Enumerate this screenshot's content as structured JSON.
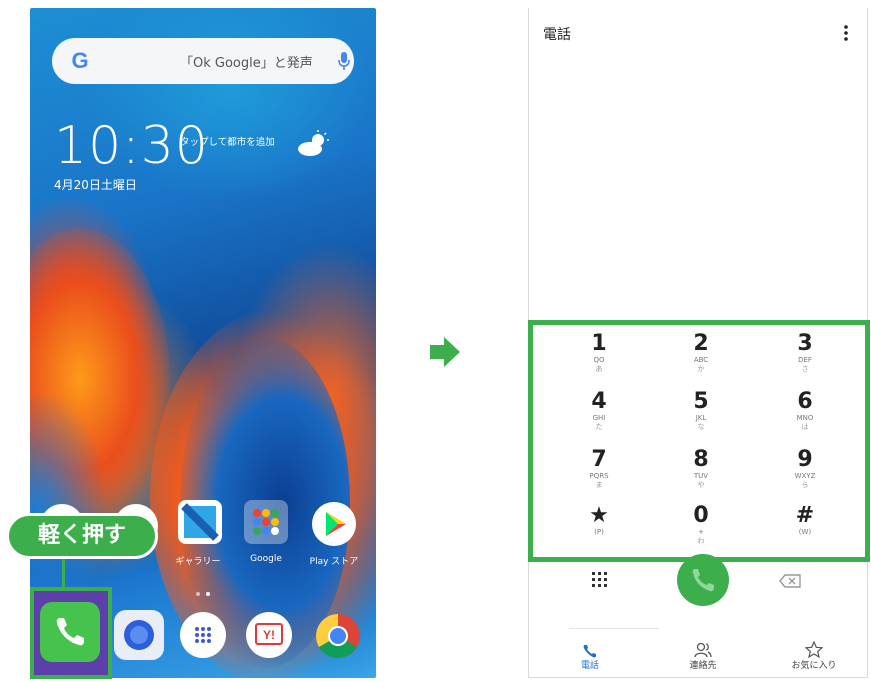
{
  "home": {
    "search_hint": "「Ok Google」と発声",
    "clock": "10:30",
    "city_hint": "タップして都市を追加",
    "date": "4月20日土曜日",
    "apps_row1": [
      {
        "label": "",
        "icon": "maps-icon"
      },
      {
        "label": "",
        "icon": "calendar-icon"
      },
      {
        "label": "ギャラリー",
        "icon": "gallery-icon"
      },
      {
        "label": "Google",
        "icon": "google-folder-icon"
      },
      {
        "label": "Play ストア",
        "icon": "play-store-icon"
      }
    ],
    "dock": [
      {
        "icon": "phone-icon"
      },
      {
        "icon": "camera-icon"
      },
      {
        "icon": "app-drawer-icon"
      },
      {
        "icon": "yahoo-icon"
      },
      {
        "icon": "chrome-icon"
      }
    ]
  },
  "callout": {
    "text": "軽く押す"
  },
  "dialer": {
    "title": "電話",
    "keys": [
      {
        "digit": "1",
        "letters": "QO",
        "kana": "あ"
      },
      {
        "digit": "2",
        "letters": "ABC",
        "kana": "か"
      },
      {
        "digit": "3",
        "letters": "DEF",
        "kana": "さ"
      },
      {
        "digit": "4",
        "letters": "GHI",
        "kana": "た"
      },
      {
        "digit": "5",
        "letters": "JKL",
        "kana": "な"
      },
      {
        "digit": "6",
        "letters": "MNO",
        "kana": "は"
      },
      {
        "digit": "7",
        "letters": "PQRS",
        "kana": "ま"
      },
      {
        "digit": "8",
        "letters": "TUV",
        "kana": "や"
      },
      {
        "digit": "9",
        "letters": "WXYZ",
        "kana": "ら"
      },
      {
        "digit": "★",
        "letters": "(P)",
        "kana": ""
      },
      {
        "digit": "0",
        "letters": "+",
        "kana": "わ"
      },
      {
        "digit": "#",
        "letters": "(W)",
        "kana": ""
      }
    ],
    "nav": [
      {
        "label": "電話",
        "icon": "phone-tab-icon"
      },
      {
        "label": "連絡先",
        "icon": "contacts-icon"
      },
      {
        "label": "お気に入り",
        "icon": "star-icon"
      }
    ]
  },
  "colors": {
    "accent": "#3cae4b"
  }
}
